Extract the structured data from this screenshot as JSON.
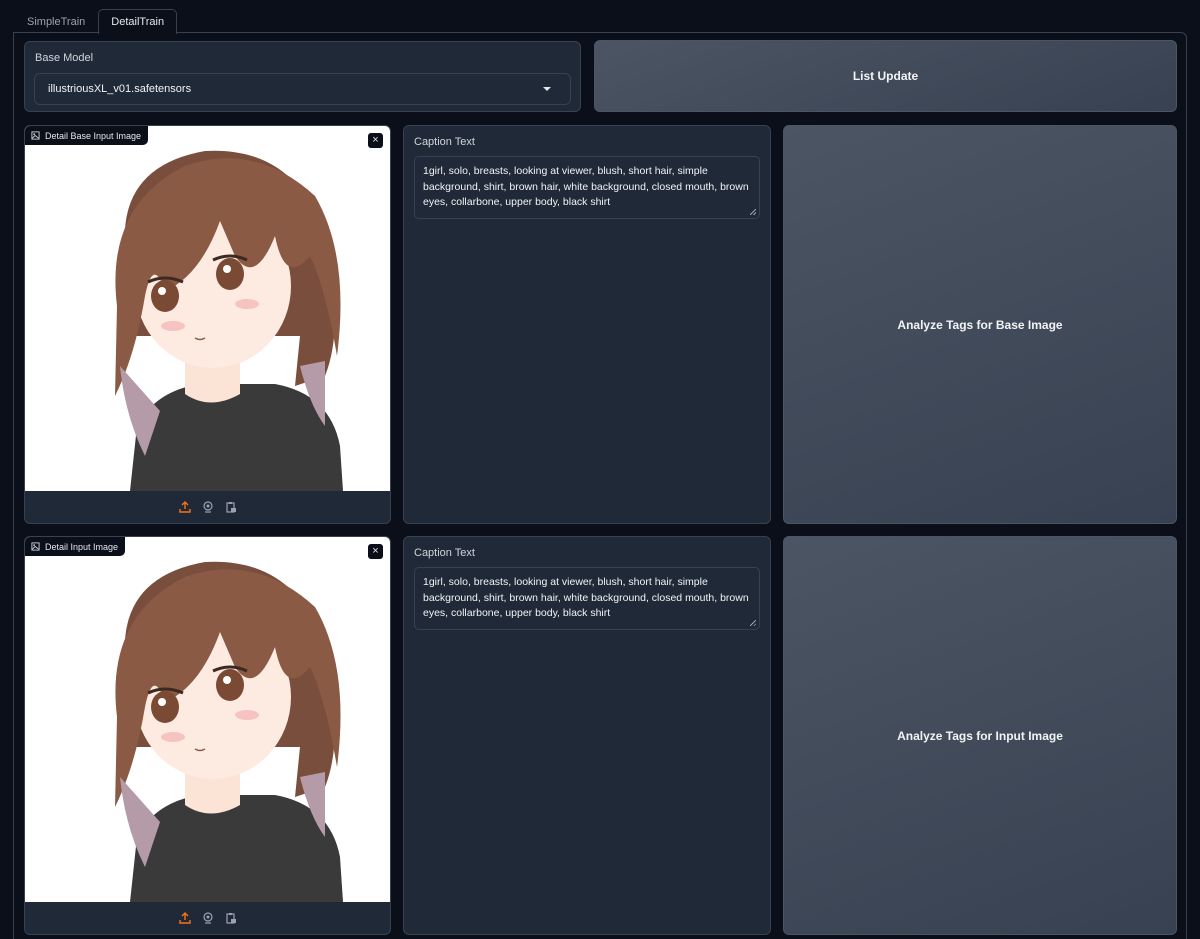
{
  "tabs": [
    {
      "label": "SimpleTrain",
      "active": false
    },
    {
      "label": "DetailTrain",
      "active": true
    }
  ],
  "base_model": {
    "label": "Base Model",
    "selected": "illustriousXL_v01.safetensors"
  },
  "list_update_button": "List Update",
  "rows": [
    {
      "image_label": "Detail Base Input Image",
      "caption_label": "Caption Text",
      "caption_value": "1girl, solo, breasts, looking at viewer, blush, short hair, simple background, shirt, brown hair, white background, closed mouth, brown eyes, collarbone, upper body, black shirt",
      "analyze_button": "Analyze Tags for Base Image"
    },
    {
      "image_label": "Detail Input Image",
      "caption_label": "Caption Text",
      "caption_value": "1girl, solo, breasts, looking at viewer, blush, short hair, simple background, shirt, brown hair, white background, closed mouth, brown eyes, collarbone, upper body, black shirt",
      "analyze_button": "Analyze Tags for Input Image"
    }
  ],
  "icons": [
    "image-icon",
    "close-icon",
    "upload-icon",
    "webcam-icon",
    "clipboard-icon",
    "chevron-down-icon"
  ],
  "colors": {
    "background": "#0b0f19",
    "panel": "#1f2937",
    "border": "#374151",
    "button": "#4b5563",
    "accent_orange": "#f97316"
  }
}
